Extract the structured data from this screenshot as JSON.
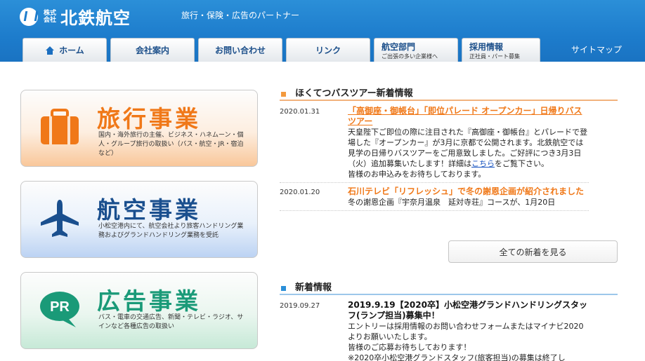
{
  "header": {
    "logo_kabushiki": "株式会社",
    "logo_name": "北鉄航空",
    "tagline": "旅行・保険・広告のパートナー",
    "sitemap": "サイトマップ"
  },
  "nav": {
    "tabs": [
      {
        "label": "ホーム",
        "sub": ""
      },
      {
        "label": "会社案内",
        "sub": ""
      },
      {
        "label": "お問い合わせ",
        "sub": ""
      },
      {
        "label": "リンク",
        "sub": ""
      },
      {
        "label": "航空部門",
        "sub": "ご出張の多い企業様へ"
      },
      {
        "label": "採用情報",
        "sub": "正社員・パート募集"
      }
    ]
  },
  "businesses": [
    {
      "title": "旅行事業",
      "desc": "国内・海外旅行の主催、ビジネス・ハネムーン・個人・グループ旅行の取扱い（バス・航空・JR・宿泊など）",
      "icon": "suitcase-icon",
      "color": "#f07818"
    },
    {
      "title": "航空事業",
      "desc": "小松空港内にて、航空会社より旅客ハンドリング業務およびグランドハンドリング業務を受託",
      "icon": "airplane-icon",
      "color": "#1a4f8e"
    },
    {
      "title": "広告事業",
      "desc": "バス・電車の交通広告、新聞・テレビ・ラジオ、サインなど各種広告の取扱い",
      "icon": "pr-icon",
      "color": "#1a9a78",
      "icon_text": "PR"
    }
  ],
  "bus_tour": {
    "heading": "ほくてつバスツアー新着情報",
    "items": [
      {
        "date": "2020.01.31",
        "title": "「高御座・御帳台」「即位パレード オープンカー」日帰りバスツアー",
        "text_before": "天皇陛下ご即位の際に注目された『高御座・御帳台』とパレードで登場した『オープンカー』が3月に京都で公開されます。北鉄航空では見学の日帰りバスツアーをご用意致しました。ご好評につき3月3日（火）追加募集いたします！詳細は",
        "link": "こちら",
        "text_after": "をご覧下さい。",
        "text2": "皆様のお申込みをお待ちしております。"
      },
      {
        "date": "2020.01.20",
        "title": "石川テレビ「リフレッシュ」で冬の謝恩企画が紹介されました",
        "text": "冬の謝恩企画『宇奈月温泉　延対寺荘』コースが、1月20日"
      }
    ],
    "more_button": "全ての新着を見る"
  },
  "news": {
    "heading": "新着情報",
    "items": [
      {
        "date": "2019.09.27",
        "title": "2019.9.19【2020卒】小松空港グランドハンドリングスタッフ(ランプ担当)募集中！",
        "text": "エントリーは採用情報のお問い合わせフォームまたはマイナビ2020よりお願いいたします。",
        "text2": "皆様のご応募お待ちしております！",
        "text3": "※2020卒小松空港グランドスタッフ(旅客担当)の募集は終了し"
      }
    ]
  }
}
